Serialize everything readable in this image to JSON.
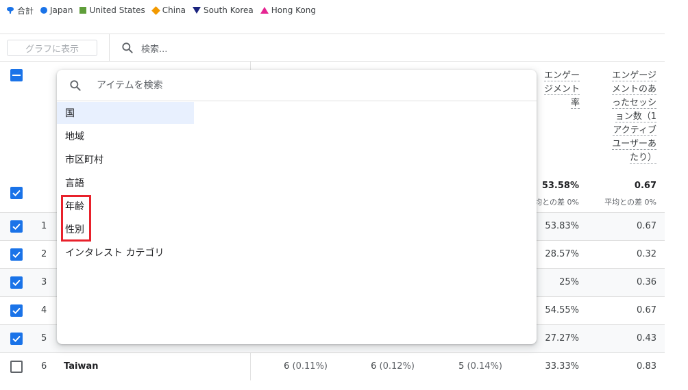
{
  "legend": [
    {
      "label": "合計",
      "icon": "total-marker-icon",
      "color": "#1a73e8"
    },
    {
      "label": "Japan",
      "icon": "circle-marker-icon",
      "color": "#1a73e8"
    },
    {
      "label": "United States",
      "icon": "square-marker-icon",
      "color": "#5f9e3a"
    },
    {
      "label": "China",
      "icon": "diamond-marker-icon",
      "color": "#f29900"
    },
    {
      "label": "South Korea",
      "icon": "triangle-down-marker-icon",
      "color": "#1a237e"
    },
    {
      "label": "Hong Kong",
      "icon": "triangle-up-marker-icon",
      "color": "#e52592"
    }
  ],
  "toolbar": {
    "plot_button_label": "グラフに表示",
    "search_placeholder": "検索..."
  },
  "columns": {
    "engagement_rate": {
      "lines": [
        "エンゲー",
        "ジメント",
        "率"
      ]
    },
    "sessions_per_user": {
      "lines": [
        "エンゲージ",
        "メントのあ",
        "ったセッシ",
        "ョン数（1",
        "アクティブ",
        "ユーザーあ",
        "たり）"
      ]
    }
  },
  "totals": {
    "engagement_rate": {
      "value": "53.58%",
      "sub": "均との差 0%"
    },
    "sessions_per_user": {
      "value": "0.67",
      "sub": "平均との差 0%"
    }
  },
  "rows": [
    {
      "num": "1",
      "checked": true,
      "engagement_rate": "53.83%",
      "sessions_per_user": "0.67"
    },
    {
      "num": "2",
      "checked": true,
      "engagement_rate": "28.57%",
      "sessions_per_user": "0.32"
    },
    {
      "num": "3",
      "checked": true,
      "engagement_rate": "25%",
      "sessions_per_user": "0.36"
    },
    {
      "num": "4",
      "checked": true,
      "engagement_rate": "54.55%",
      "sessions_per_user": "0.67"
    },
    {
      "num": "5",
      "checked": true,
      "engagement_rate": "27.27%",
      "sessions_per_user": "0.43"
    },
    {
      "num": "6",
      "checked": false,
      "name": "Taiwan",
      "c1": "6",
      "c1_pct": "(0.11%)",
      "c2": "6",
      "c2_pct": "(0.12%)",
      "c3": "5",
      "c3_pct": "(0.14%)",
      "engagement_rate": "33.33%",
      "sessions_per_user": "0.83"
    }
  ],
  "popup": {
    "search_placeholder": "アイテムを検索",
    "items": [
      {
        "label": "国",
        "selected": true
      },
      {
        "label": "地域"
      },
      {
        "label": "市区町村"
      },
      {
        "label": "言語"
      },
      {
        "label": "年齢"
      },
      {
        "label": "性別"
      },
      {
        "label": "インタレスト カテゴリ"
      }
    ]
  },
  "colors": {
    "accent": "#1a73e8",
    "highlight": "#e8212b"
  }
}
